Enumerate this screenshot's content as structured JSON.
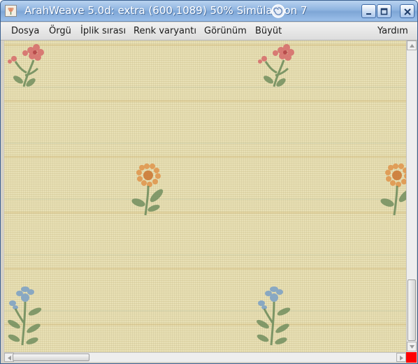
{
  "window": {
    "title": "ArahWeave 5.0d: extra (600,1089) 50% Simülasyon 7",
    "title_icon": "arahweave-app-icon",
    "status_icon": "swirl-icon",
    "controls": [
      "minimize-icon",
      "maximize-icon",
      "close-icon"
    ]
  },
  "menubar": {
    "items": [
      "Dosya",
      "Örgü",
      "İplik sırası",
      "Renk varyantı",
      "Görünüm",
      "Büyüt"
    ],
    "help": "Yardım"
  },
  "canvas": {
    "description_icon": "woven-fabric-floral-motifs",
    "colors": {
      "background": "#e9e1b6",
      "red_flower": "#d66a6a",
      "orange_flower": "#e0944a",
      "blue_flower": "#7aa0c6",
      "leaves": "#6b8a5a"
    }
  },
  "indicator": {
    "color": "#ff0000"
  }
}
